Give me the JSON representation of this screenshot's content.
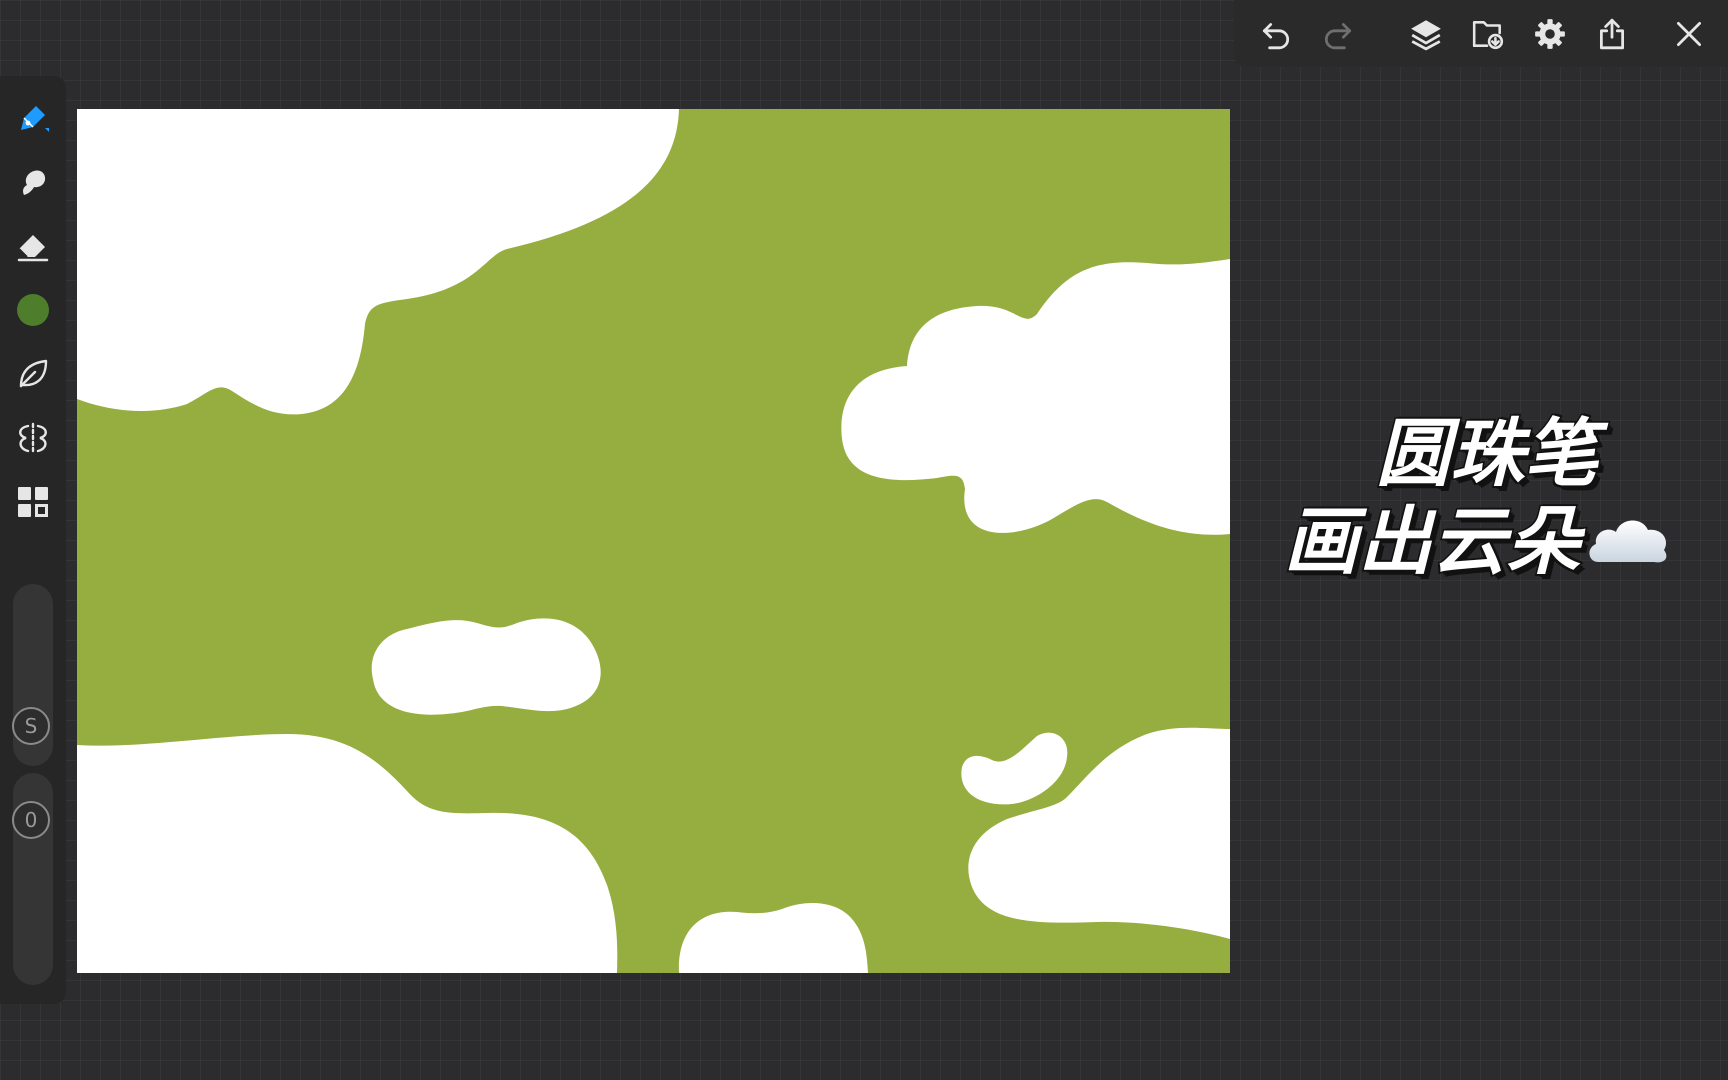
{
  "toolbar": {
    "undo": "undo-icon",
    "redo": "redo-icon",
    "layers": "layers-icon",
    "import": "import-icon",
    "settings": "gear-icon",
    "export": "share-icon",
    "close": "close-icon"
  },
  "sidebar": {
    "tools": [
      {
        "name": "pen-tool",
        "icon": "pen-icon",
        "active": true
      },
      {
        "name": "smudge-tool",
        "icon": "smudge-icon"
      },
      {
        "name": "eraser-tool",
        "icon": "eraser-icon"
      },
      {
        "name": "color-picker",
        "icon": "color-swatch",
        "color": "#4e7d2c"
      },
      {
        "name": "lasso-tool",
        "icon": "leaf-icon"
      },
      {
        "name": "symmetry-tool",
        "icon": "symmetry-icon"
      },
      {
        "name": "grid-tool",
        "icon": "grid-icon"
      }
    ],
    "size_slider_label": "S",
    "opacity_slider_label": "0"
  },
  "canvas": {
    "background_color": "#96ad40",
    "cloud_color": "#ffffff"
  },
  "caption": {
    "line1": "圆珠笔",
    "line2": "画出云朵",
    "emoji": "cloud-emoji"
  },
  "colors": {
    "accent": "#1e9bff",
    "toolbar_bg": "#2a2a2a",
    "sidebar_bg": "#262626"
  }
}
